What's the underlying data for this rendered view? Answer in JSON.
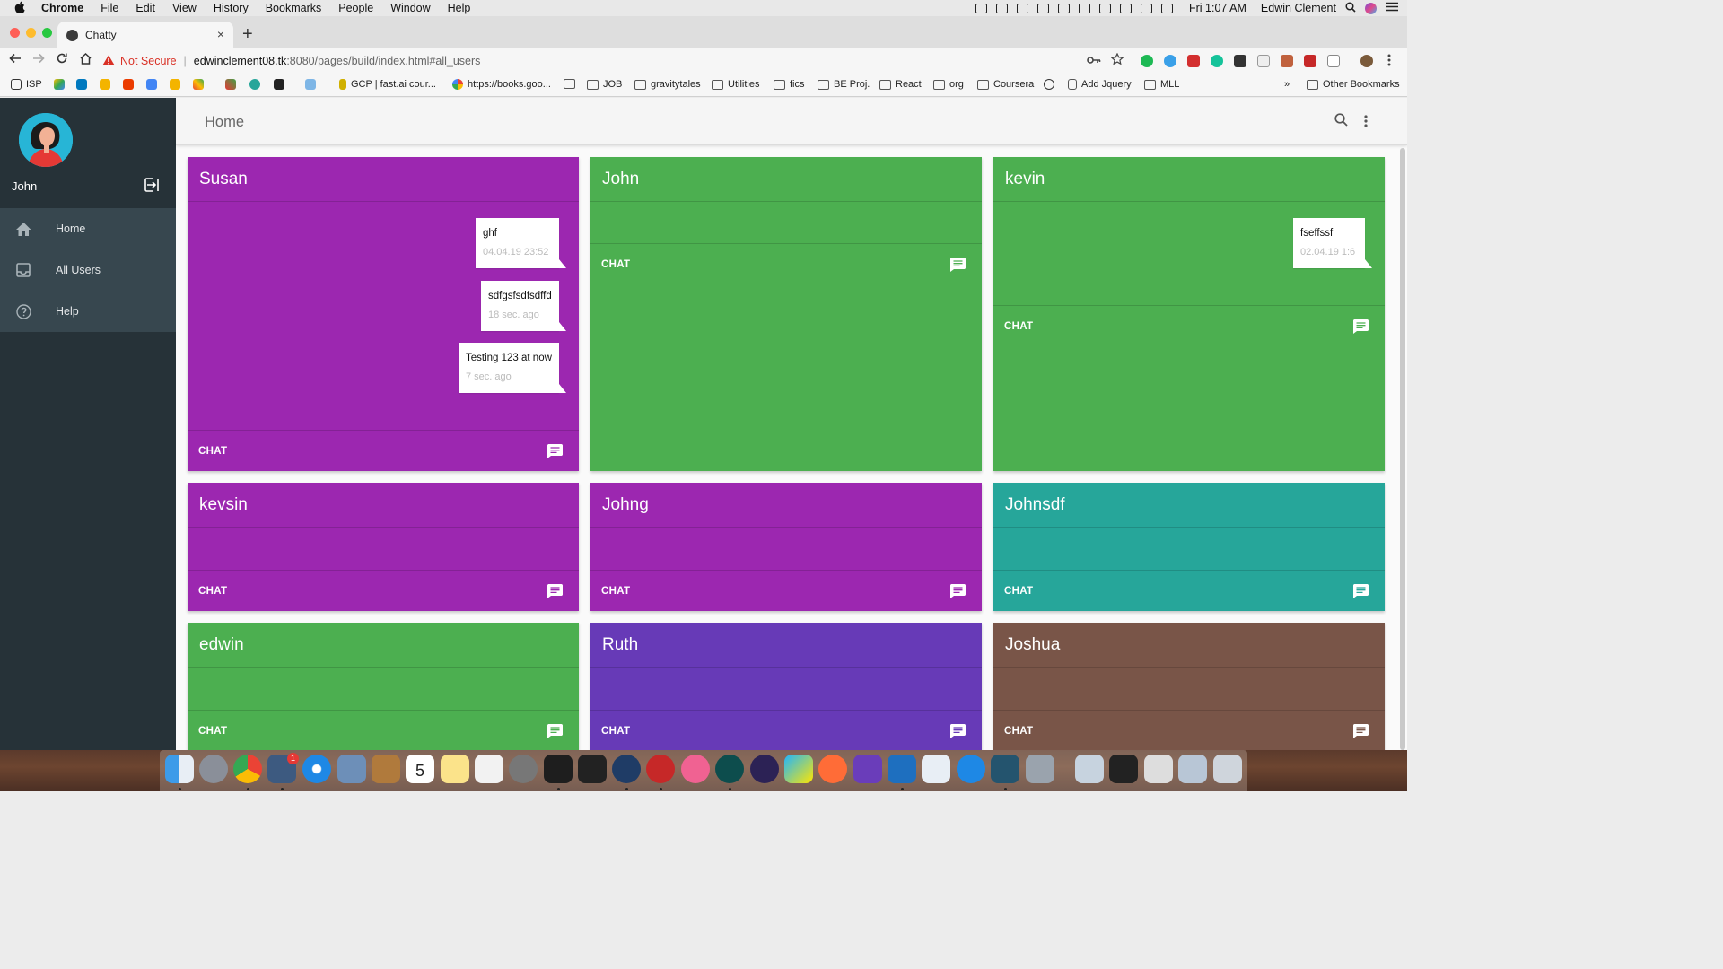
{
  "menubar": {
    "items": [
      "Chrome",
      "File",
      "Edit",
      "View",
      "History",
      "Bookmarks",
      "People",
      "Window",
      "Help"
    ],
    "clock": "Fri 1:07 AM",
    "user": "Edwin Clement"
  },
  "browser": {
    "tab_title": "Chatty",
    "tab_close": "×",
    "new_tab": "+",
    "security_label": "Not Secure",
    "url_host": "edwinclement08.tk",
    "url_path": ":8080/pages/build/index.html#all_users",
    "bookmarks": [
      "ISP",
      "GCP | fast.ai cour...",
      "https://books.goo...",
      "JOB",
      "gravitytales",
      "Utilities",
      "fics",
      "BE Proj.",
      "React",
      "org",
      "Coursera",
      "Add Jquery",
      "MLL",
      "»",
      "Other Bookmarks"
    ]
  },
  "app": {
    "drawer_user": "John",
    "nav": [
      {
        "label": "Home",
        "icon": "home-icon"
      },
      {
        "label": "All Users",
        "icon": "inbox-icon"
      },
      {
        "label": "Help",
        "icon": "help-icon"
      }
    ],
    "header_title": "Home",
    "chat_label": "CHAT",
    "cards": [
      {
        "name": "Susan",
        "color": "#9c27b0",
        "messages": [
          {
            "text": "ghf",
            "time": "04.04.19 23:52"
          },
          {
            "text": "sdfgsfsdfsdffd",
            "time": "18 sec. ago"
          },
          {
            "text": "Testing 123 at now",
            "time": "7 sec. ago"
          }
        ]
      },
      {
        "name": "John",
        "color": "#4caf50",
        "messages": []
      },
      {
        "name": "kevin",
        "color": "#4caf50",
        "messages": [
          {
            "text": "fseffssf",
            "time": "02.04.19 1:6"
          }
        ]
      },
      {
        "name": "kevsin",
        "color": "#9c27b0",
        "messages": []
      },
      {
        "name": "Johng",
        "color": "#9c27b0",
        "messages": []
      },
      {
        "name": "Johnsdf",
        "color": "#26a69a",
        "messages": []
      },
      {
        "name": "edwin",
        "color": "#4caf50",
        "messages": []
      },
      {
        "name": "Ruth",
        "color": "#673ab7",
        "messages": []
      },
      {
        "name": "Joshua",
        "color": "#795548",
        "messages": []
      }
    ]
  },
  "dock": {
    "notification_badge": "1",
    "calendar_day": "5"
  }
}
